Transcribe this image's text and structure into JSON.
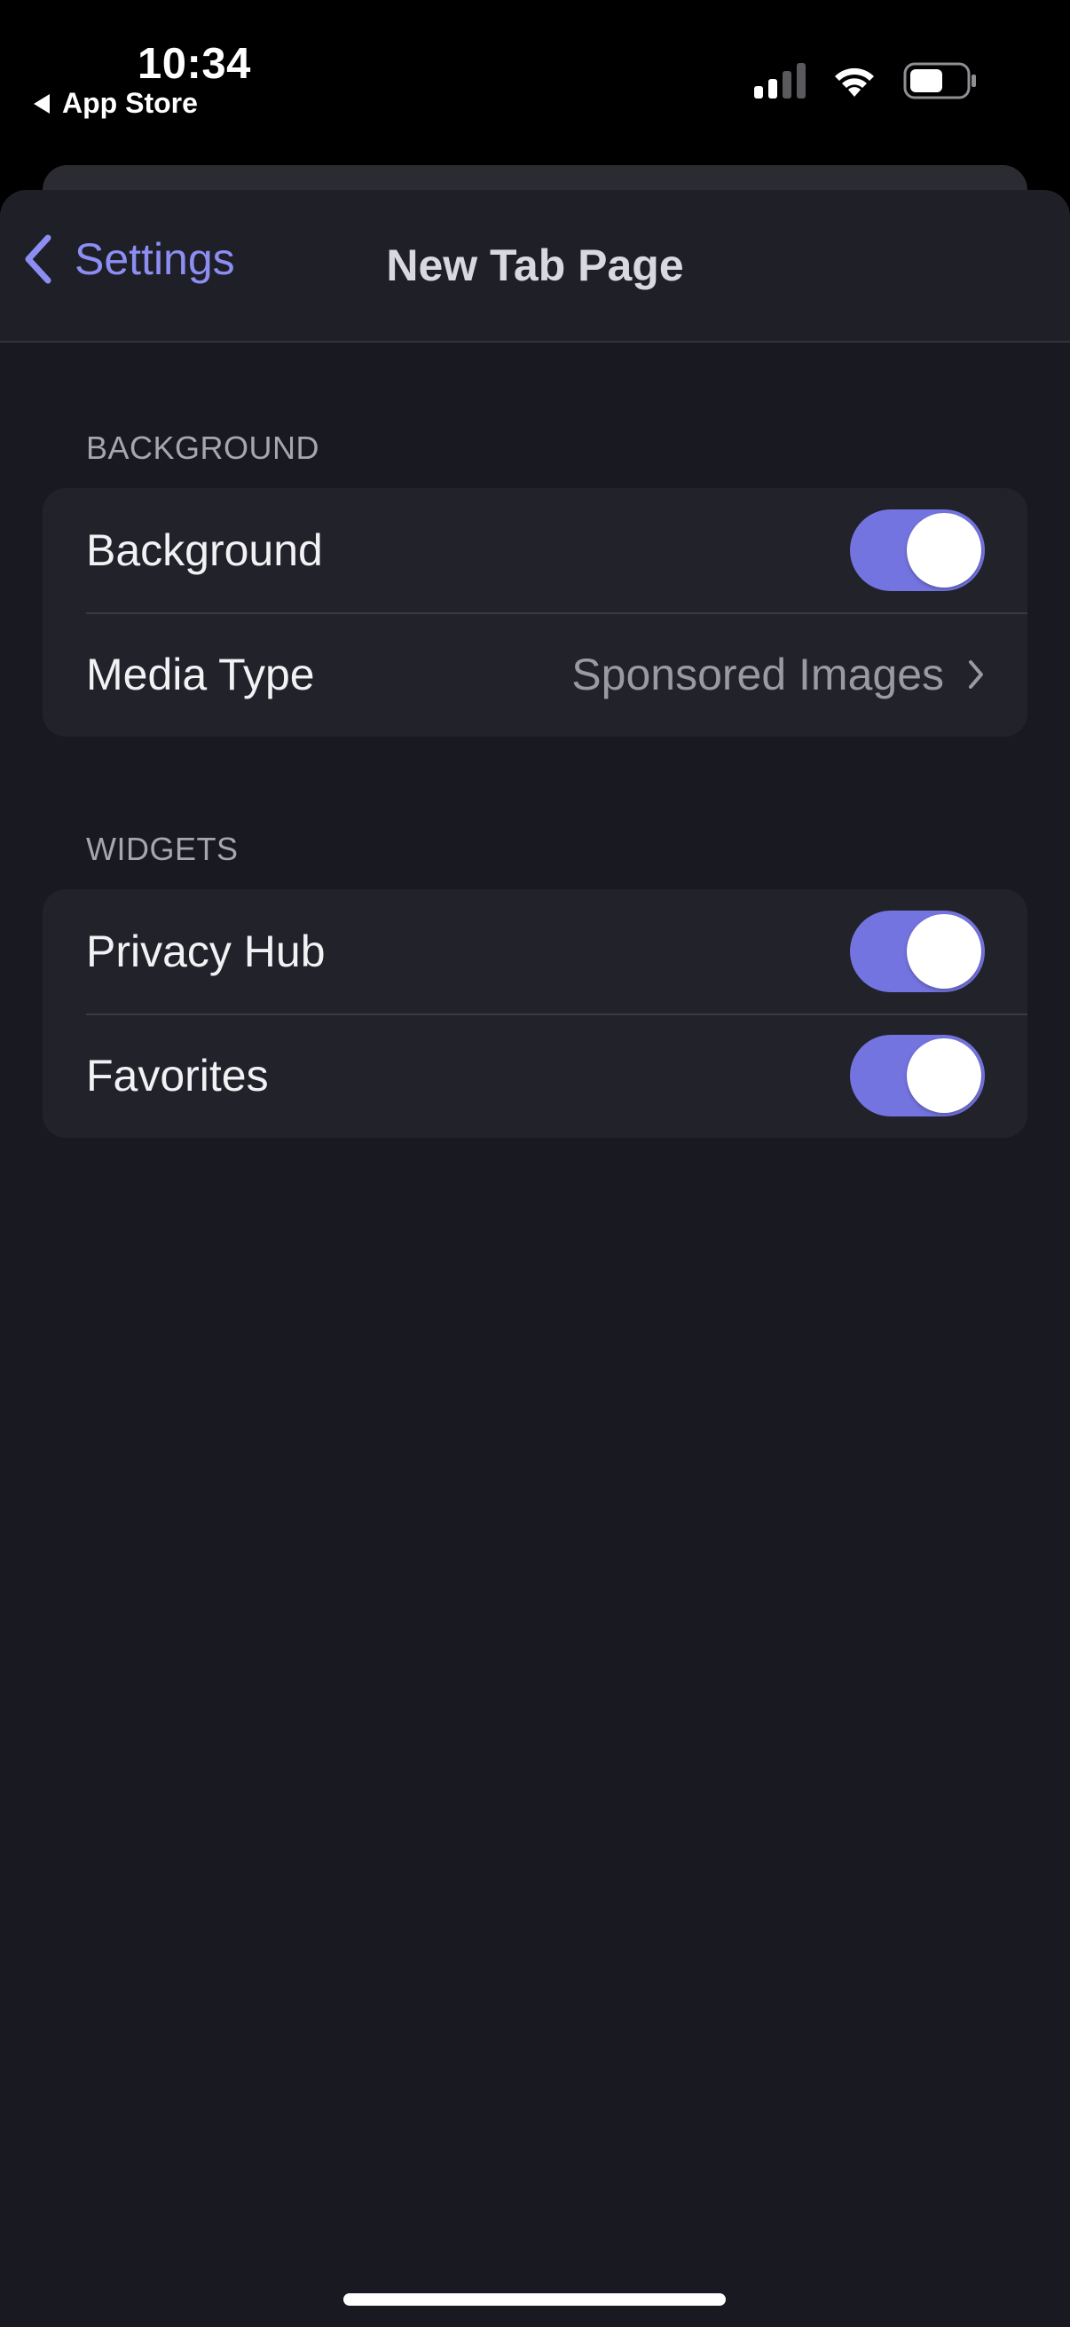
{
  "status_bar": {
    "time": "10:34",
    "back_app": "App Store",
    "icons": [
      "cellular-signal-icon",
      "wifi-icon",
      "battery-icon"
    ]
  },
  "navbar": {
    "back_label": "Settings",
    "title": "New Tab Page"
  },
  "sections": {
    "background": {
      "header": "BACKGROUND",
      "rows": {
        "background": {
          "label": "Background",
          "toggle_on": true
        },
        "media_type": {
          "label": "Media Type",
          "value": "Sponsored Images"
        }
      }
    },
    "widgets": {
      "header": "WIDGETS",
      "rows": {
        "privacy_hub": {
          "label": "Privacy Hub",
          "toggle_on": true
        },
        "favorites": {
          "label": "Favorites",
          "toggle_on": true
        }
      }
    }
  },
  "colors": {
    "accent": "#8c8ef2",
    "toggle_on": "#7474e0",
    "sheet_bg": "#191921",
    "group_bg": "#22222b"
  }
}
